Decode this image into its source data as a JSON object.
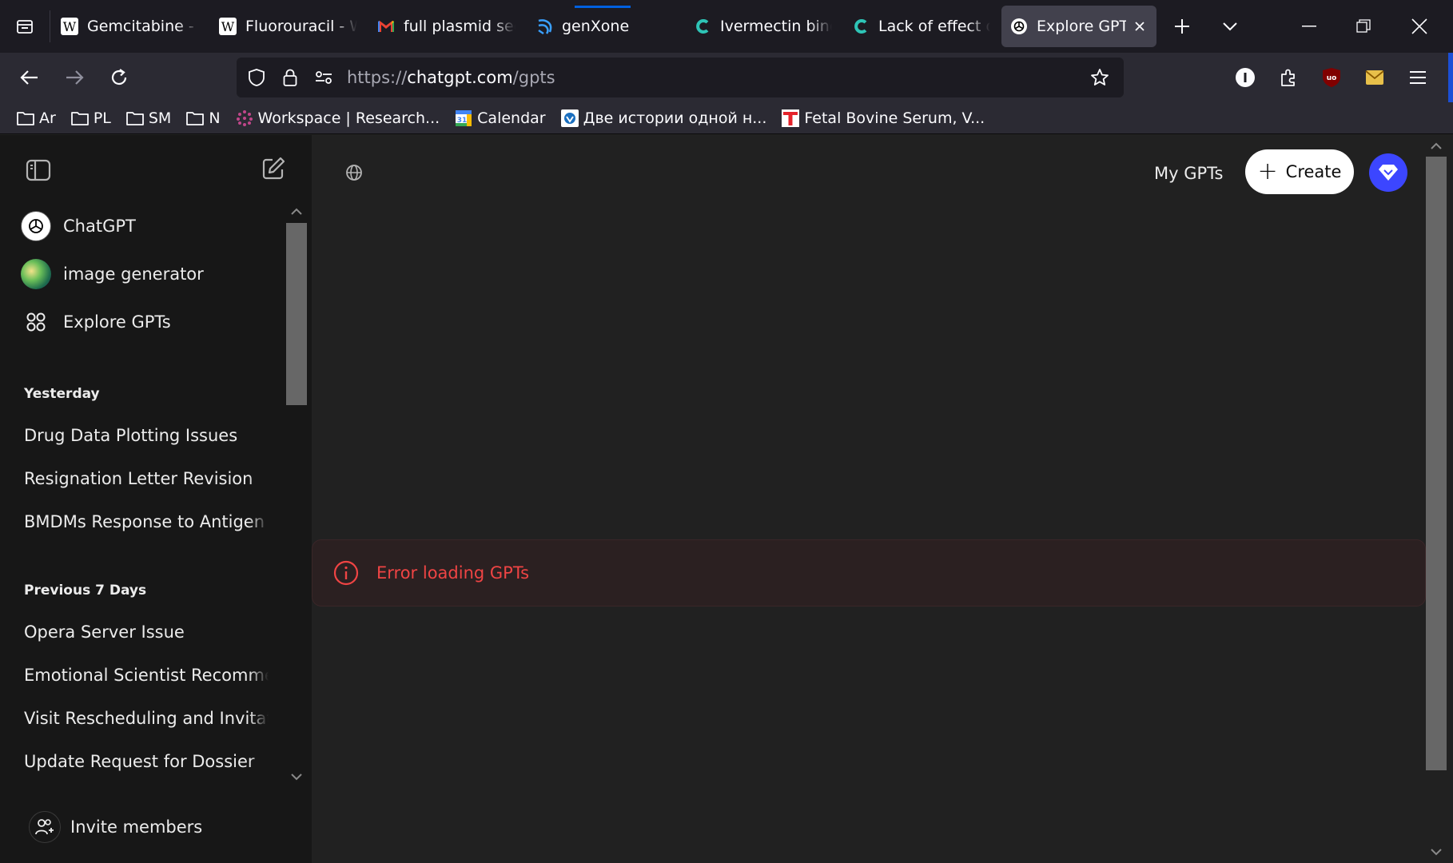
{
  "tabs": [
    {
      "title": "Gemcitabine - Wikipedia",
      "favicon": "wikipedia-icon"
    },
    {
      "title": "Fluorouracil - Wikipedia",
      "favicon": "wikipedia-icon"
    },
    {
      "title": "full plasmid sequence",
      "favicon": "gmail-icon"
    },
    {
      "title": "genXone",
      "favicon": "genxone-icon"
    },
    {
      "title": "Ivermectin binds",
      "favicon": "consensus-icon"
    },
    {
      "title": "Lack of effect of",
      "favicon": "consensus-icon"
    },
    {
      "title": "Explore GPTs",
      "favicon": "openai-icon",
      "active": true
    }
  ],
  "address": {
    "scheme": "https://",
    "host": "chatgpt.com",
    "path": "/gpts"
  },
  "bookmarks": [
    {
      "label": "Ar",
      "icon": "folder-icon"
    },
    {
      "label": "PL",
      "icon": "folder-icon"
    },
    {
      "label": "SM",
      "icon": "folder-icon"
    },
    {
      "label": "N",
      "icon": "folder-icon"
    },
    {
      "label": "Workspace | Research...",
      "icon": "workspace-icon"
    },
    {
      "label": "Calendar",
      "icon": "calendar-icon"
    },
    {
      "label": "Две истории одной н...",
      "icon": "site-icon"
    },
    {
      "label": "Fetal Bovine Serum, V...",
      "icon": "t-logo-icon"
    }
  ],
  "sidebar": {
    "pinned": [
      {
        "label": "ChatGPT",
        "icon": "openai-icon"
      },
      {
        "label": "image generator",
        "icon": "image-generator-avatar"
      },
      {
        "label": "Explore GPTs",
        "icon": "grid-icon"
      }
    ],
    "groups": [
      {
        "heading": "Yesterday",
        "chats": [
          "Drug Data Plotting Issues",
          "Resignation Letter Revision",
          "BMDMs Response to Antigen"
        ]
      },
      {
        "heading": "Previous 7 Days",
        "chats": [
          "Opera Server Issue",
          "Emotional Scientist Recommendations",
          "Visit Rescheduling and Invitation",
          "Update Request for Dossier"
        ]
      }
    ],
    "invite_label": "Invite members"
  },
  "main": {
    "my_gpts_label": "My GPTs",
    "create_label": "Create",
    "error_text": "Error loading GPTs"
  },
  "colors": {
    "accent": "#3c46ff",
    "error": "#ef4444",
    "sidebar_bg": "#171717",
    "main_bg": "#212121"
  }
}
